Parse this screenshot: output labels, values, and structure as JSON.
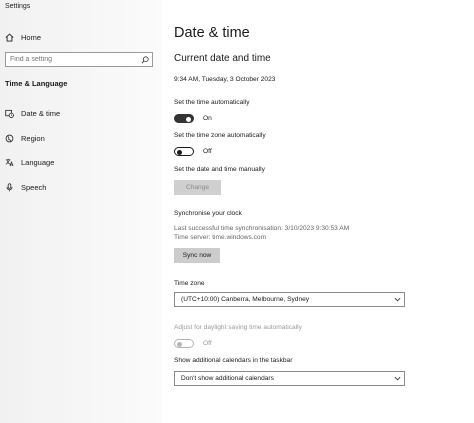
{
  "app": {
    "title": "Settings"
  },
  "sidebar": {
    "home": {
      "label": "Home",
      "icon": "home-icon"
    },
    "search": {
      "placeholder": "Find a setting",
      "icon": "search-icon"
    },
    "section_header": "Time & Language",
    "items": [
      {
        "label": "Date & time",
        "icon": "calendar-clock-icon"
      },
      {
        "label": "Region",
        "icon": "globe-icon"
      },
      {
        "label": "Language",
        "icon": "language-icon"
      },
      {
        "label": "Speech",
        "icon": "microphone-icon"
      }
    ]
  },
  "main": {
    "title": "Date & time",
    "subtitle": "Current date and time",
    "current_datetime": "9:34 AM, Tuesday, 3 October 2023",
    "set_time_auto": {
      "label": "Set the time automatically",
      "state": "On"
    },
    "set_tz_auto": {
      "label": "Set the time zone automatically",
      "state": "Off"
    },
    "set_manual": {
      "label": "Set the date and time manually",
      "button": "Change"
    },
    "sync": {
      "heading": "Synchronise your clock",
      "last_sync": "Last successful time synchronisation: 3/10/2023 9:30:53 AM",
      "server": "Time server: time.windows.com",
      "button": "Sync now"
    },
    "time_zone": {
      "label": "Time zone",
      "value": "(UTC+10:00) Canberra, Melbourne, Sydney"
    },
    "dst": {
      "label": "Adjust for daylight saving time automatically",
      "state": "Off"
    },
    "calendars": {
      "label": "Show additional calendars in the taskbar",
      "value": "Don't show additional calendars"
    }
  },
  "colors": {
    "sidebar_bg": "#f2f2f2",
    "toggle_on": "#333333",
    "button_bg": "#cccccc",
    "disabled_text": "#8a8a8a"
  }
}
